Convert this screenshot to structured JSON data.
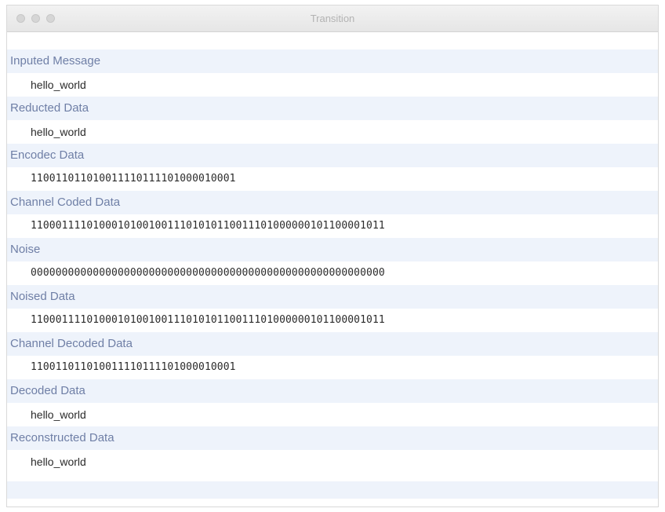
{
  "window": {
    "title": "Transition"
  },
  "entries": [
    {
      "label": "Inputed Message",
      "value": "hello_world",
      "mono": false
    },
    {
      "label": "Reducted Data",
      "value": "hello_world",
      "mono": false
    },
    {
      "label": "Encodec Data",
      "value": "110011011010011110111101000010001",
      "mono": true
    },
    {
      "label": "Channel Coded Data",
      "value": "110001111010001010010011101010110011101000000101100001011",
      "mono": true
    },
    {
      "label": "Noise",
      "value": "000000000000000000000000000000000000000000000000000000000",
      "mono": true
    },
    {
      "label": "Noised Data",
      "value": "110001111010001010010011101010110011101000000101100001011",
      "mono": true
    },
    {
      "label": "Channel Decoded Data",
      "value": "110011011010011110111101000010001",
      "mono": true
    },
    {
      "label": "Decoded Data",
      "value": "hello_world",
      "mono": false
    },
    {
      "label": "Reconstructed Data",
      "value": "hello_world",
      "mono": false
    }
  ]
}
